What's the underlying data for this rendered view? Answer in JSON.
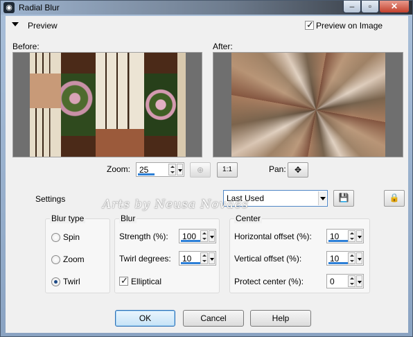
{
  "window": {
    "title": "Radial Blur"
  },
  "preview": {
    "header_label": "Preview",
    "preview_on_image_label": "Preview on Image",
    "preview_on_image_checked": true,
    "before_label": "Before:",
    "after_label": "After:",
    "zoom_label": "Zoom:",
    "zoom_value": "25",
    "pan_label": "Pan:",
    "fit_button_label": "1:1"
  },
  "settings": {
    "label": "Settings",
    "preset_value": "Last Used"
  },
  "watermark": {
    "text": "Arts by Neusa Novaes"
  },
  "blur_type": {
    "title": "Blur type",
    "options": [
      {
        "label": "Spin",
        "selected": false
      },
      {
        "label": "Zoom",
        "selected": false
      },
      {
        "label": "Twirl",
        "selected": true
      }
    ]
  },
  "blur": {
    "title": "Blur",
    "strength_label": "Strength (%):",
    "strength_value": "100",
    "twirl_label": "Twirl degrees:",
    "twirl_value": "10",
    "elliptical_label": "Elliptical",
    "elliptical_checked": true
  },
  "center": {
    "title": "Center",
    "h_offset_label": "Horizontal offset (%):",
    "h_offset_value": "10",
    "v_offset_label": "Vertical offset (%):",
    "v_offset_value": "10",
    "protect_label": "Protect center (%):",
    "protect_value": "0"
  },
  "buttons": {
    "ok": "OK",
    "cancel": "Cancel",
    "help": "Help"
  }
}
